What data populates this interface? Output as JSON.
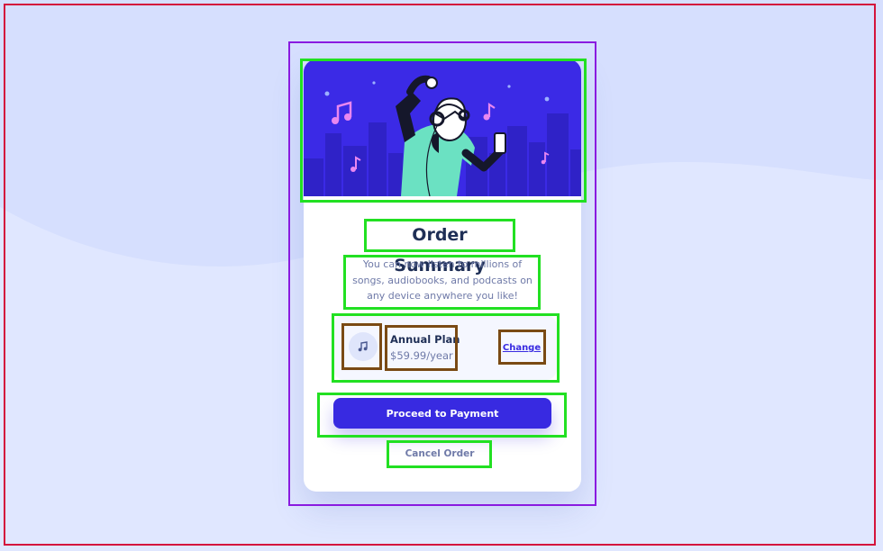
{
  "order_card": {
    "title": "Order Summary",
    "description": "You can now listen to millions of songs, audiobooks, and podcasts on any device anywhere you like!",
    "plan": {
      "icon": "music-note-icon",
      "name": "Annual Plan",
      "price": "$59.99/year",
      "change_label": "Change"
    },
    "proceed_label": "Proceed to Payment",
    "cancel_label": "Cancel Order"
  },
  "colors": {
    "page_background": "#d6dffe",
    "accent": "#382ae1",
    "heading": "#1f2f56",
    "muted_text": "#6f7aa8",
    "highlight_green": "#22e022",
    "highlight_brown": "#7a4a14",
    "outline_red": "#d4143c",
    "outline_purple": "#8a1be0"
  }
}
